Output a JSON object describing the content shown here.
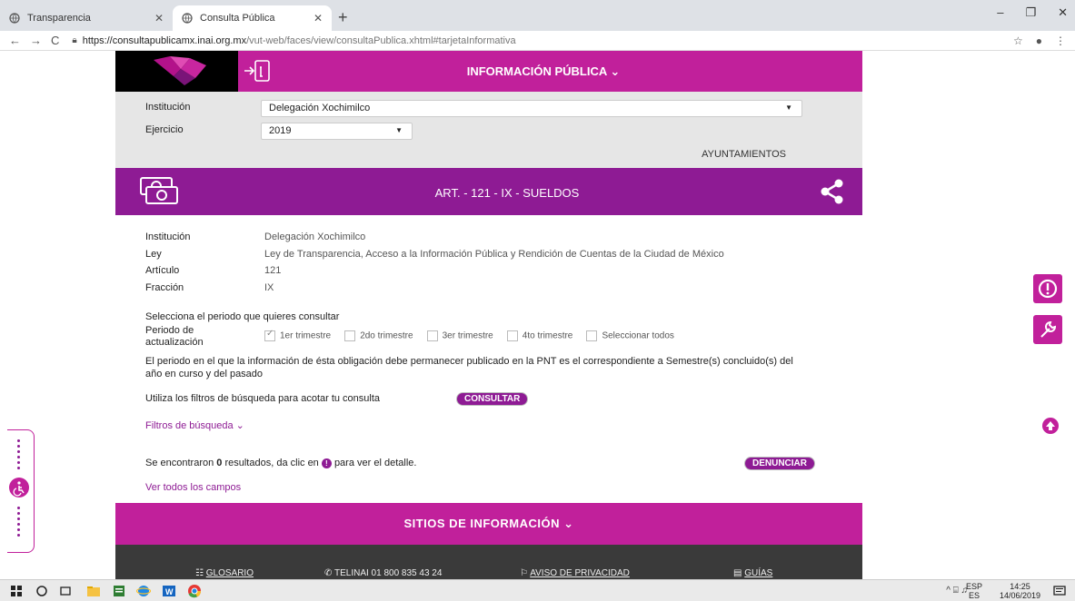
{
  "browser": {
    "tabs": [
      {
        "label": "Transparencia"
      },
      {
        "label": "Consulta Pública"
      }
    ],
    "url_host": "https://consultapublicamx.inai.org.mx",
    "url_path": "/vut-web/faces/view/consultaPublica.xhtml#tarjetaInformativa"
  },
  "header": {
    "title": "INFORMACIÓN PÚBLICA ⌄"
  },
  "filters": {
    "institucion_label": "Institución",
    "institucion_value": "Delegación Xochimilco",
    "ejercicio_label": "Ejercicio",
    "ejercicio_value": "2019",
    "ayuntamientos": "AYUNTAMIENTOS"
  },
  "article": {
    "title": "ART. - 121 - IX - SUELDOS"
  },
  "details": [
    {
      "label": "Institución",
      "value": "Delegación Xochimilco"
    },
    {
      "label": "Ley",
      "value": "Ley de Transparencia, Acceso a la Información Pública y Rendición de Cuentas de la Ciudad de México"
    },
    {
      "label": "Artículo",
      "value": "121"
    },
    {
      "label": "Fracción",
      "value": "IX"
    }
  ],
  "periodo": {
    "prompt": "Selecciona el periodo que quieres consultar",
    "label_line1": "Periodo de",
    "label_line2": "actualización",
    "options": [
      {
        "label": "1er trimestre",
        "checked": true
      },
      {
        "label": "2do trimestre",
        "checked": false
      },
      {
        "label": "3er trimestre",
        "checked": false
      },
      {
        "label": "4to trimestre",
        "checked": false
      },
      {
        "label": "Seleccionar todos",
        "checked": false
      }
    ],
    "note_line1": "El periodo en el que la información de ésta obligación debe permanecer publicado en la PNT es el correspondiente a Semestre(s) concluido(s) del",
    "note_line2": "año en curso y del pasado"
  },
  "search": {
    "hint": "Utiliza los filtros de búsqueda para acotar tu consulta",
    "consultar": "CONSULTAR",
    "filtros": "Filtros de búsqueda ⌄",
    "results_pre": "Se encontraron",
    "results_count": "0",
    "results_mid": "resultados, da clic en",
    "results_post": "para ver el detalle.",
    "denunciar": "DENUNCIAR",
    "ver_todos": "Ver todos los campos"
  },
  "sitios": {
    "title": "SITIOS DE INFORMACIÓN ⌄"
  },
  "footer": {
    "glosario": "GLOSARIO",
    "telinai": "TELINAI 01 800 835 43 24",
    "aviso": "AVISO DE PRIVACIDAD",
    "guias": "GUÍAS"
  },
  "taskbar": {
    "lang1": "ESP",
    "lang2": "ES",
    "time": "14:25",
    "date": "14/06/2019"
  },
  "colors": {
    "magenta": "#c1209b",
    "purple": "#8e1b94"
  }
}
